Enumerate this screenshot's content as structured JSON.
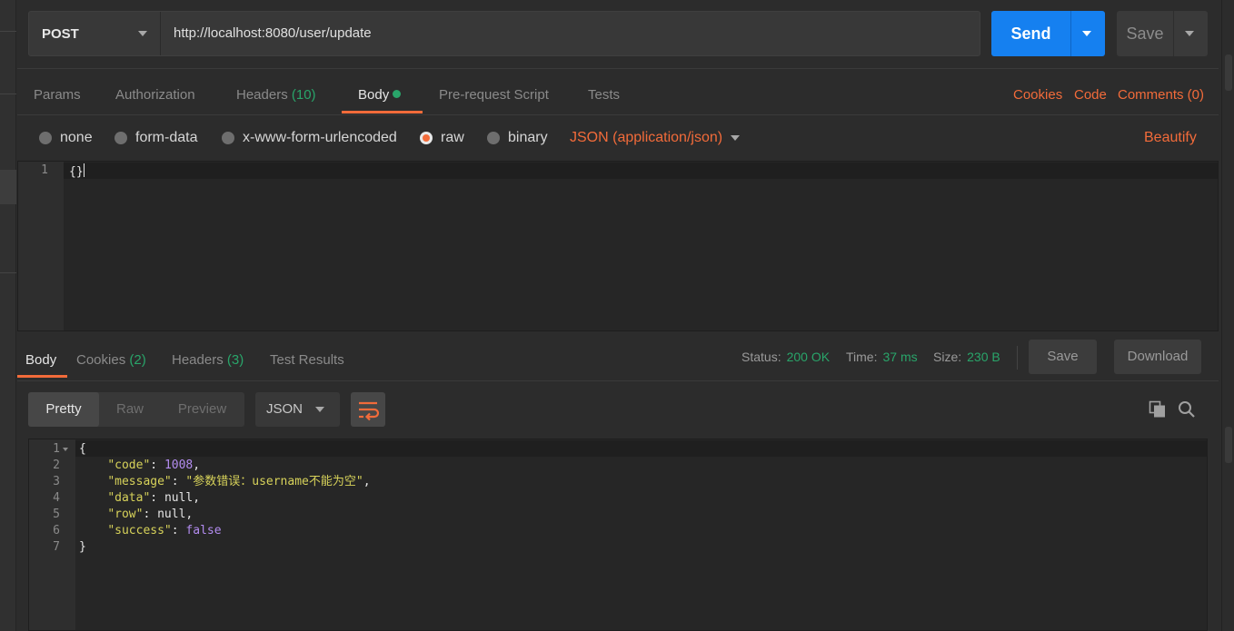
{
  "request": {
    "method": "POST",
    "url": "http://localhost:8080/user/update",
    "send_label": "Send",
    "save_label": "Save"
  },
  "request_tabs": [
    {
      "label": "Params",
      "count": ""
    },
    {
      "label": "Authorization",
      "count": ""
    },
    {
      "label": "Headers",
      "count": "(10)"
    },
    {
      "label": "Body",
      "count": ""
    },
    {
      "label": "Pre-request Script",
      "count": ""
    },
    {
      "label": "Tests",
      "count": ""
    }
  ],
  "active_request_tab": "Body",
  "request_links": {
    "cookies": "Cookies",
    "code": "Code",
    "comments": "Comments (0)"
  },
  "body_types": [
    "none",
    "form-data",
    "x-www-form-urlencoded",
    "raw",
    "binary"
  ],
  "selected_body_type": "raw",
  "content_type": "JSON (application/json)",
  "beautify_label": "Beautify",
  "request_editor": {
    "line_number": "1",
    "code": "{}"
  },
  "response_tabs": [
    {
      "label": "Body",
      "count": ""
    },
    {
      "label": "Cookies",
      "count": "(2)"
    },
    {
      "label": "Headers",
      "count": "(3)"
    },
    {
      "label": "Test Results",
      "count": ""
    }
  ],
  "response_meta": {
    "status_label": "Status:",
    "status_value": "200 OK",
    "time_label": "Time:",
    "time_value": "37 ms",
    "size_label": "Size:",
    "size_value": "230 B"
  },
  "response_buttons": {
    "save": "Save",
    "download": "Download"
  },
  "view_modes": [
    "Pretty",
    "Raw",
    "Preview"
  ],
  "selected_view_mode": "Pretty",
  "format": "JSON",
  "response_body": {
    "lines": [
      {
        "no": "1",
        "text": "{"
      },
      {
        "no": "2",
        "key": "\"code\"",
        "value": "1008",
        "vtype": "num"
      },
      {
        "no": "3",
        "key": "\"message\"",
        "value": "\"参数错误：username不能为空\"",
        "vtype": "str"
      },
      {
        "no": "4",
        "key": "\"data\"",
        "value": "null",
        "vtype": "null"
      },
      {
        "no": "5",
        "key": "\"row\"",
        "value": "null",
        "vtype": "null"
      },
      {
        "no": "6",
        "key": "\"success\"",
        "value": "false",
        "vtype": "bool"
      },
      {
        "no": "7",
        "text": "}"
      }
    ]
  },
  "colors": {
    "accent": "#f26b3a",
    "send_blue": "#1580f0",
    "success_green": "#29a56a",
    "json_key": "#d7d25a",
    "json_number": "#b38cf0"
  }
}
